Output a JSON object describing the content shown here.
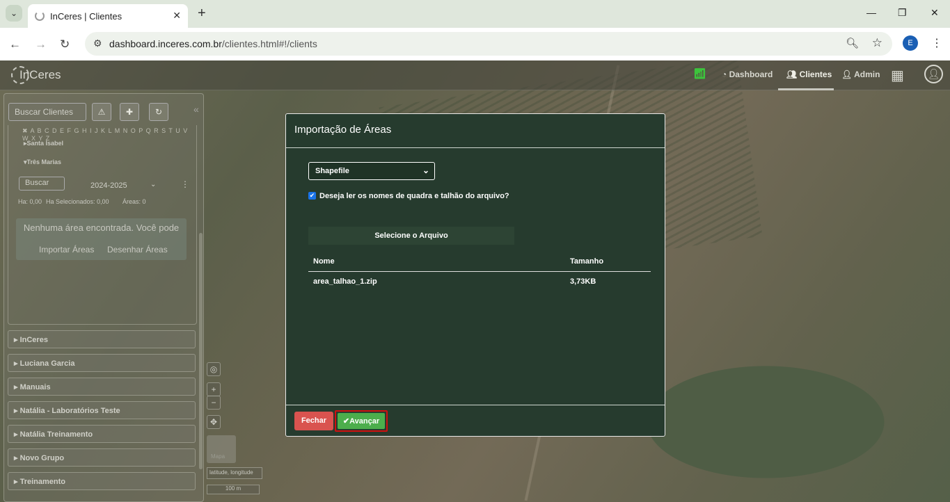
{
  "browser": {
    "tab_title": "InCeres | Clientes",
    "url_domain": "dashboard.inceres.com.br",
    "url_path": "/clientes.html#!/clients",
    "profile_initial": "E"
  },
  "app": {
    "logo_text": "InCeres",
    "nav": {
      "dashboard": "Dashboard",
      "clientes": "Clientes",
      "admin": "Admin"
    }
  },
  "sidebar": {
    "search_placeholder": "Buscar Clientes",
    "alphabet": "✖ A B C D E F G H I J K L M N O P Q R S T U V W X Y Z",
    "farms": [
      "Santa Isabel",
      "Três Marias"
    ],
    "area_search_placeholder": "Buscar",
    "season": "2024-2025",
    "stats": {
      "ha": "Ha: 0,00",
      "ha_selected": "Ha Selecionados: 0,00",
      "areas": "Áreas: 0"
    },
    "empty_message": "Nenhuma área encontrada. Você pode",
    "import_link": "Importar Áreas",
    "draw_link": "Desenhar Áreas",
    "groups": [
      "InCeres",
      "Luciana Garcia",
      "Manuais",
      "Natália - Laboratórios Teste",
      "Natália Treinamento",
      "Novo Grupo",
      "Treinamento"
    ]
  },
  "map": {
    "layer_label": "Mapa",
    "coords_label": "latitude, longitude",
    "scale_label": "100 m"
  },
  "modal": {
    "title": "Importação de Áreas",
    "format_selected": "Shapefile",
    "checkbox_label": "Deseja ler os nomes de quadra e talhão do arquivo?",
    "checkbox_checked": true,
    "file_button": "Selecione o Arquivo",
    "table": {
      "headers": [
        "Nome",
        "Tamanho"
      ],
      "rows": [
        [
          "area_talhao_1.zip",
          "3,73KB"
        ]
      ]
    },
    "close_button": "Fechar",
    "next_button": "Avançar"
  }
}
